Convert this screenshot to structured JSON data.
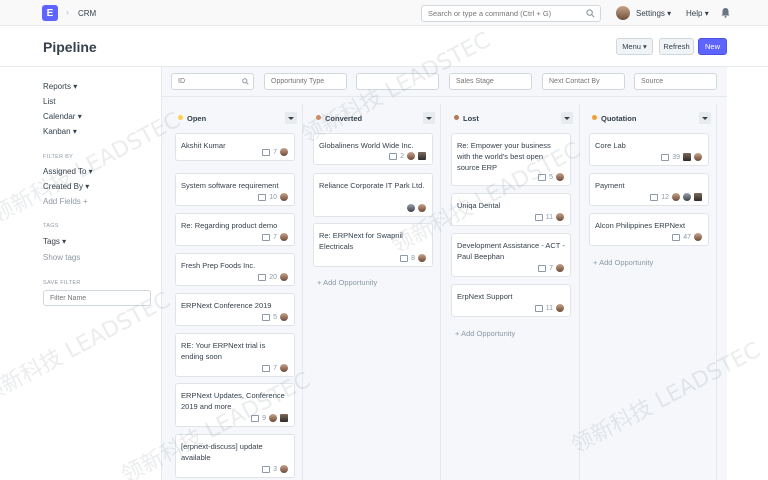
{
  "navbar": {
    "logo_letter": "E",
    "breadcrumb": "CRM",
    "search_placeholder": "Search or type a command (Ctrl + G)",
    "settings_label": "Settings",
    "help_label": "Help"
  },
  "page": {
    "title": "Pipeline",
    "menu_label": "Menu",
    "refresh_label": "Refresh",
    "new_label": "New"
  },
  "sidebar": {
    "reports": "Reports",
    "list": "List",
    "calendar": "Calendar",
    "kanban": "Kanban",
    "filter_by_heading": "FILTER BY",
    "assigned_to": "Assigned To",
    "created_by": "Created By",
    "add_fields": "Add Fields",
    "tags_heading": "TAGS",
    "tags": "Tags",
    "show_tags": "Show tags",
    "save_filter_heading": "SAVE FILTER",
    "filter_name_placeholder": "Filter Name"
  },
  "filters": {
    "id_placeholder": "ID",
    "opportunity_type_placeholder": "Opportunity Type",
    "blank_placeholder": "",
    "sales_stage_placeholder": "Sales Stage",
    "next_contact_placeholder": "Next Contact By",
    "source_placeholder": "Source"
  },
  "columns": [
    {
      "title": "Open",
      "color": "#f8d24a",
      "cards": [
        {
          "title": "Akshit Kumar",
          "count": "7"
        },
        {
          "title": "System software requirement",
          "count": "10"
        },
        {
          "title": "Re: Regarding product demo",
          "count": "7"
        },
        {
          "title": "Fresh Prep Foods Inc.",
          "count": "20"
        },
        {
          "title": "ERPNext Conference 2019",
          "count": "5"
        },
        {
          "title": "RE: Your ERPNext trial is ending soon",
          "count": "7"
        },
        {
          "title": "ERPNext Updates, Conference 2019 and more",
          "count": "9"
        },
        {
          "title": "[erpnext-discuss] update available",
          "count": "3"
        }
      ]
    },
    {
      "title": "Converted",
      "color": "#d18c5c",
      "cards": [
        {
          "title": "Globalinens World Wide Inc.",
          "count": "2"
        },
        {
          "title": "Reliance Corporate IT Park Ltd.",
          "count": ""
        },
        {
          "title": "Re: ERPNext for Swapnil Electricals",
          "count": "8"
        }
      ],
      "add_label": "Add Opportunity"
    },
    {
      "title": "Lost",
      "color": "#b07a5a",
      "cards": [
        {
          "title": "Re: Empower your business with the world's best open source ERP",
          "count": "5"
        },
        {
          "title": "Uniqa Dental",
          "count": "11"
        },
        {
          "title": "Development Assistance - ACT - Paul Beephan",
          "count": "7"
        },
        {
          "title": "ErpNext Support",
          "count": "11"
        }
      ],
      "add_label": "Add Opportunity"
    },
    {
      "title": "Quotation",
      "color": "#f0a030",
      "cards": [
        {
          "title": "Core Lab",
          "count": "39"
        },
        {
          "title": "Payment",
          "count": "12"
        },
        {
          "title": "Alcon Philippines ERPNext",
          "count": "47"
        }
      ],
      "add_label": "Add Opportunity"
    }
  ],
  "watermark": "领新科技 LEADSTEC"
}
